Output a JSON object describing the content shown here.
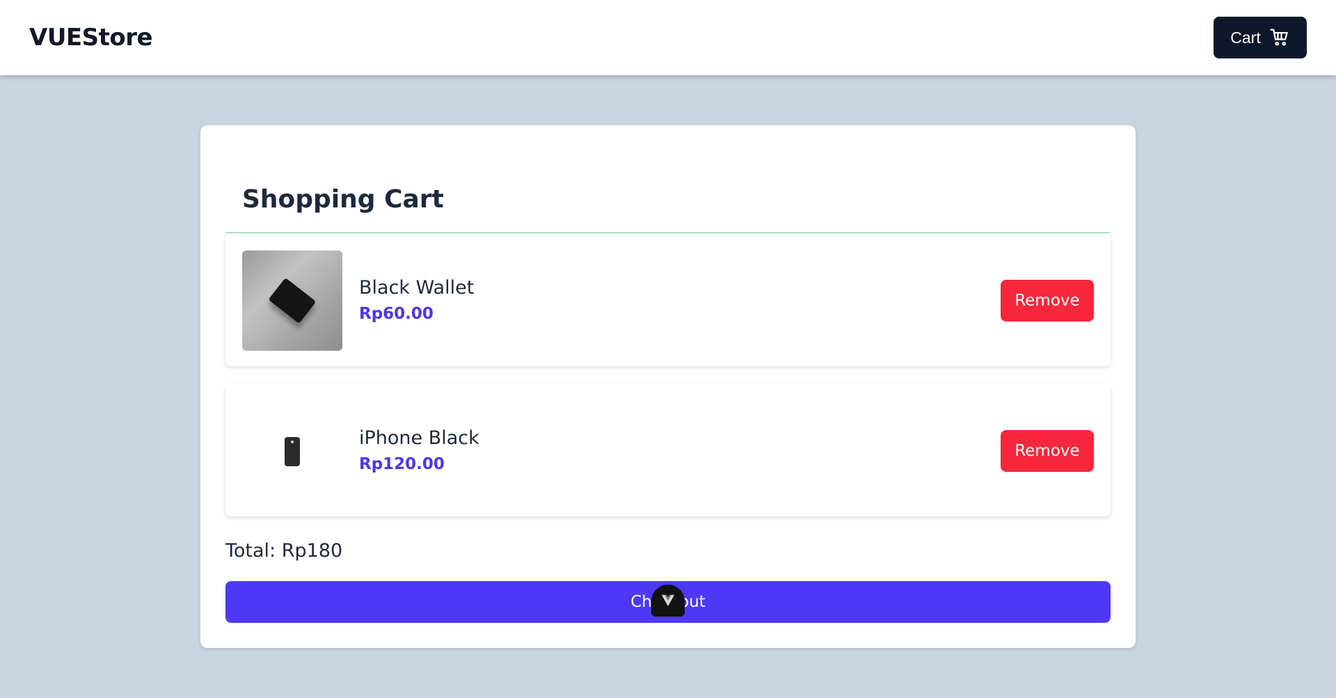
{
  "navbar": {
    "brand": "VUEStore",
    "cart_label": "Cart",
    "cart_icon": "shopping-cart-icon"
  },
  "cart": {
    "title": "Shopping Cart",
    "items": [
      {
        "name": "Black Wallet",
        "price": "Rp60.00",
        "image": "black-wallet-photo",
        "remove_label": "Remove"
      },
      {
        "name": "iPhone Black",
        "price": "Rp120.00",
        "image": "iphone-black-photo",
        "remove_label": "Remove"
      }
    ],
    "total": "Total: Rp180",
    "checkout_label": "Checkout"
  },
  "devtools": {
    "icon": "vue-devtools-icon"
  },
  "colors": {
    "page_background": "#c8d4e0",
    "navbar_button": "#0f172a",
    "price": "#4f35e8",
    "remove": "#f8273b",
    "checkout": "#4f39f6",
    "divider": "#6fcf97"
  }
}
